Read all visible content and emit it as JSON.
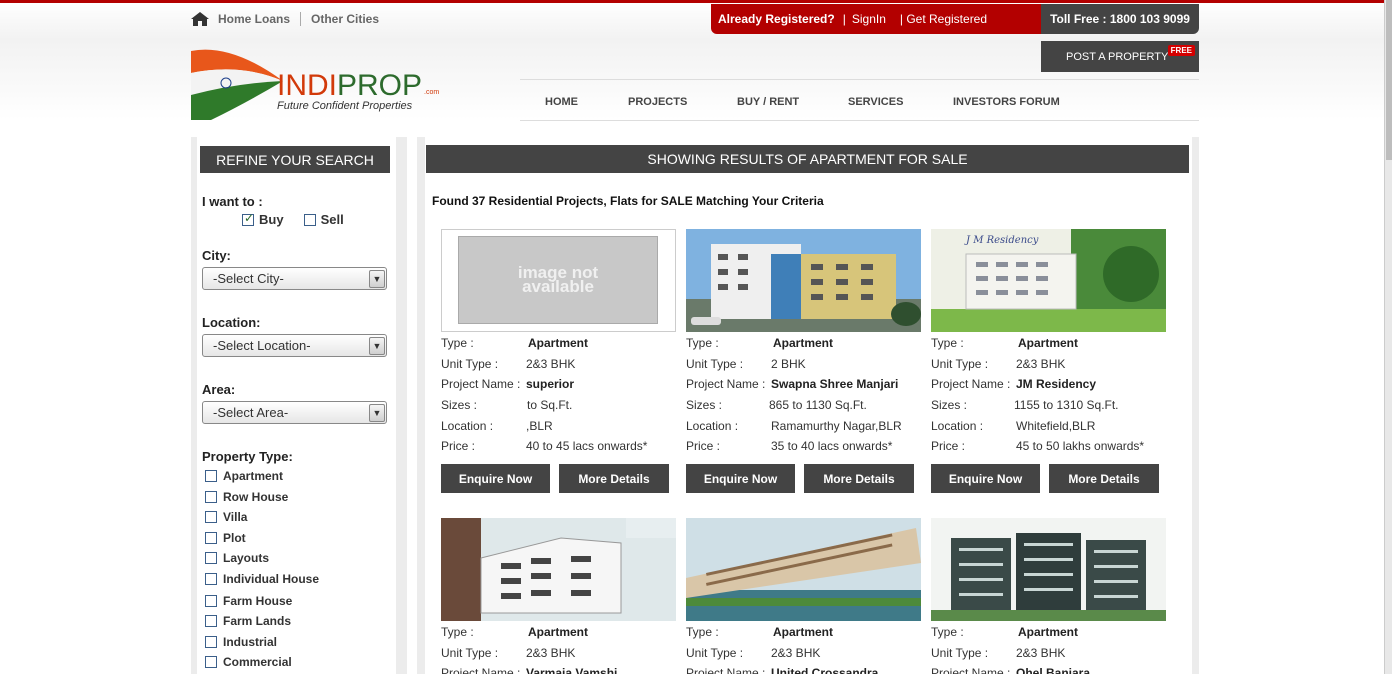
{
  "top_nav": {
    "home_loans": "Home Loans",
    "other_cities": "Other Cities"
  },
  "registration": {
    "already": "Already Registered?",
    "signin": "SignIn",
    "get_registered": "| Get Registered"
  },
  "toll_free": "Toll Free : 1800 103 9099",
  "post_property": {
    "label": "POST A PROPERTY",
    "badge": "FREE"
  },
  "logo": {
    "brand_part1": "INDI",
    "brand_part2": "PROP",
    "dotcom": ".com",
    "tagline": "Future Confident Properties"
  },
  "main_nav": [
    "HOME",
    "PROJECTS",
    "BUY / RENT",
    "SERVICES",
    "INVESTORS FORUM"
  ],
  "sidebar": {
    "title": "REFINE YOUR SEARCH",
    "want_label": "I want to :",
    "buy": "Buy",
    "sell": "Sell",
    "buy_checked": true,
    "sell_checked": false,
    "city_label": "City:",
    "city_value": "-Select City-",
    "location_label": "Location:",
    "location_value": "-Select Location-",
    "area_label": "Area:",
    "area_value": "-Select Area-",
    "property_type_label": "Property Type:",
    "property_types": [
      "Apartment",
      "Row House",
      "Villa",
      "Plot",
      "Layouts",
      "Individual House",
      "Farm House",
      "Farm Lands",
      "Industrial",
      "Commercial"
    ]
  },
  "results": {
    "header": "SHOWING RESULTS OF APARTMENT FOR SALE",
    "found_text": "Found 37 Residential Projects, Flats for SALE Matching Your Criteria",
    "labels": {
      "type": "Type :",
      "unit_type": "Unit Type :",
      "project_name": "Project Name :",
      "sizes": "Sizes :",
      "location": "Location :",
      "price": "Price :"
    },
    "buttons": {
      "enquire": "Enquire Now",
      "details": "More Details"
    },
    "image_not_available": "image not available",
    "jm_caption": "J M Residency",
    "cards": [
      {
        "type": "Apartment",
        "unit_type": "2&3 BHK",
        "project_name": "superior",
        "sizes": "to  Sq.Ft.",
        "location": ",BLR",
        "price": "40 to 45 lacs onwards*",
        "image": "placeholder"
      },
      {
        "type": "Apartment",
        "unit_type": "2 BHK",
        "project_name": "Swapna Shree Manjari",
        "sizes": "865 to 1130 Sq.Ft.",
        "location": "Ramamurthy Nagar,BLR",
        "price": "35 to 40 lacs onwards*",
        "image": "building"
      },
      {
        "type": "Apartment",
        "unit_type": "2&3 BHK",
        "project_name": "JM Residency",
        "sizes": "1155 to 1310 Sq.Ft.",
        "location": "Whitefield,BLR",
        "price": "45 to 50 lakhs onwards*",
        "image": "building-green"
      },
      {
        "type": "Apartment",
        "unit_type": "2&3 BHK",
        "project_name": "Varmaja Vamshi",
        "image": "building-white"
      },
      {
        "type": "Apartment",
        "unit_type": "2&3 BHK",
        "project_name": "United Crossandra",
        "image": "building-lake"
      },
      {
        "type": "Apartment",
        "unit_type": "2&3 BHK",
        "project_name": "Ohel Banjara",
        "image": "building-dark"
      }
    ]
  },
  "colors": {
    "brand_red": "#b30000",
    "dark_gray": "#444444",
    "logo_orange": "#d23a0a",
    "logo_green": "#2d6b2d"
  }
}
